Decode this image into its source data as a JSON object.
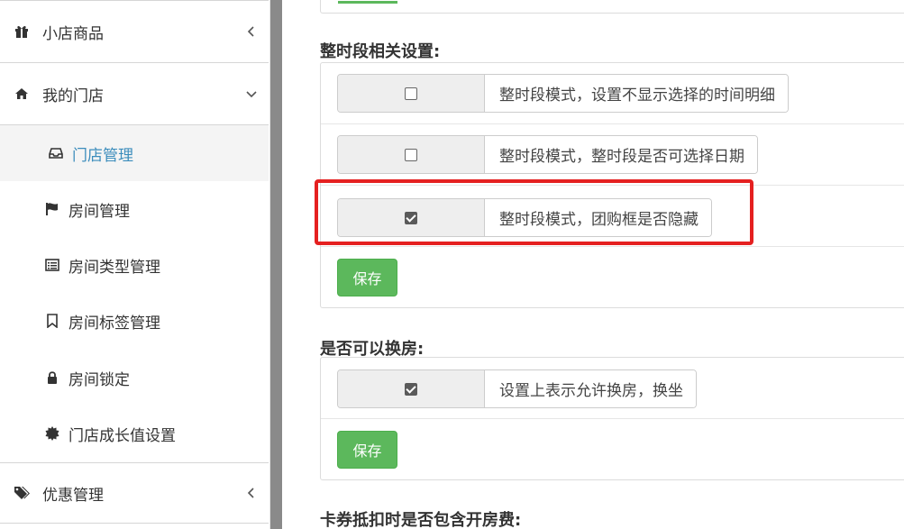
{
  "sidebar": {
    "items": [
      {
        "label": "小店商品",
        "icon": "gift-icon",
        "arrow": "chevron-left-icon"
      },
      {
        "label": "我的门店",
        "icon": "home-icon",
        "arrow": "chevron-down-icon"
      },
      {
        "label": "优惠管理",
        "icon": "tags-icon",
        "arrow": "chevron-left-icon"
      }
    ],
    "sub_items": [
      {
        "label": "门店管理",
        "icon": "inbox-icon",
        "active": true
      },
      {
        "label": "房间管理",
        "icon": "flag-icon"
      },
      {
        "label": "房间类型管理",
        "icon": "list-alt-icon"
      },
      {
        "label": "房间标签管理",
        "icon": "bookmark-icon"
      },
      {
        "label": "房间锁定",
        "icon": "lock-icon"
      },
      {
        "label": "门店成长值设置",
        "icon": "certificate-icon"
      }
    ]
  },
  "main": {
    "section_hourly": {
      "title": "整时段相关设置:",
      "options": [
        {
          "label": "整时段模式，设置不显示选择的时间明细",
          "checked": false
        },
        {
          "label": "整时段模式，整时段是否可选择日期",
          "checked": false
        },
        {
          "label": "整时段模式，团购框是否隐藏",
          "checked": true
        }
      ],
      "save_label": "保存"
    },
    "section_room_change": {
      "title": "是否可以换房:",
      "options": [
        {
          "label": "设置上表示允许换房，换坐",
          "checked": true
        }
      ],
      "save_label": "保存"
    },
    "section_coupon": {
      "title": "卡券抵扣时是否包含开房费:"
    }
  },
  "colors": {
    "accent": "#3c8dbc",
    "save_button": "#5cb85c",
    "highlight": "#e52020"
  }
}
